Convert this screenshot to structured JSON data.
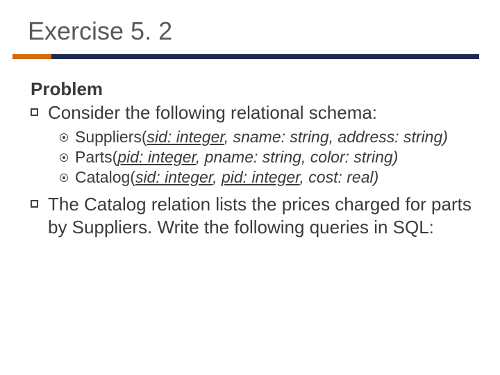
{
  "title": "Exercise 5. 2",
  "problem_label": "Problem",
  "items": {
    "a": "Consider the following relational schema:",
    "b": "The Catalog relation lists the prices charged for parts by Suppliers. Write the following queries in SQL:"
  },
  "schemas": {
    "suppliers": {
      "name": "Suppliers(",
      "key": "sid: integer",
      "rest": ", sname: string, address: string)"
    },
    "parts": {
      "name": "Parts(",
      "key": "pid: integer",
      "rest": ", pname: string, color: string)"
    },
    "catalog": {
      "name": "Catalog(",
      "key1": "sid: integer",
      "sep": ", ",
      "key2": "pid: integer",
      "rest": ", cost: real)"
    }
  },
  "colors": {
    "accent": "#d16b0f",
    "bar": "#1f2a53",
    "text": "#3a3a3a"
  }
}
